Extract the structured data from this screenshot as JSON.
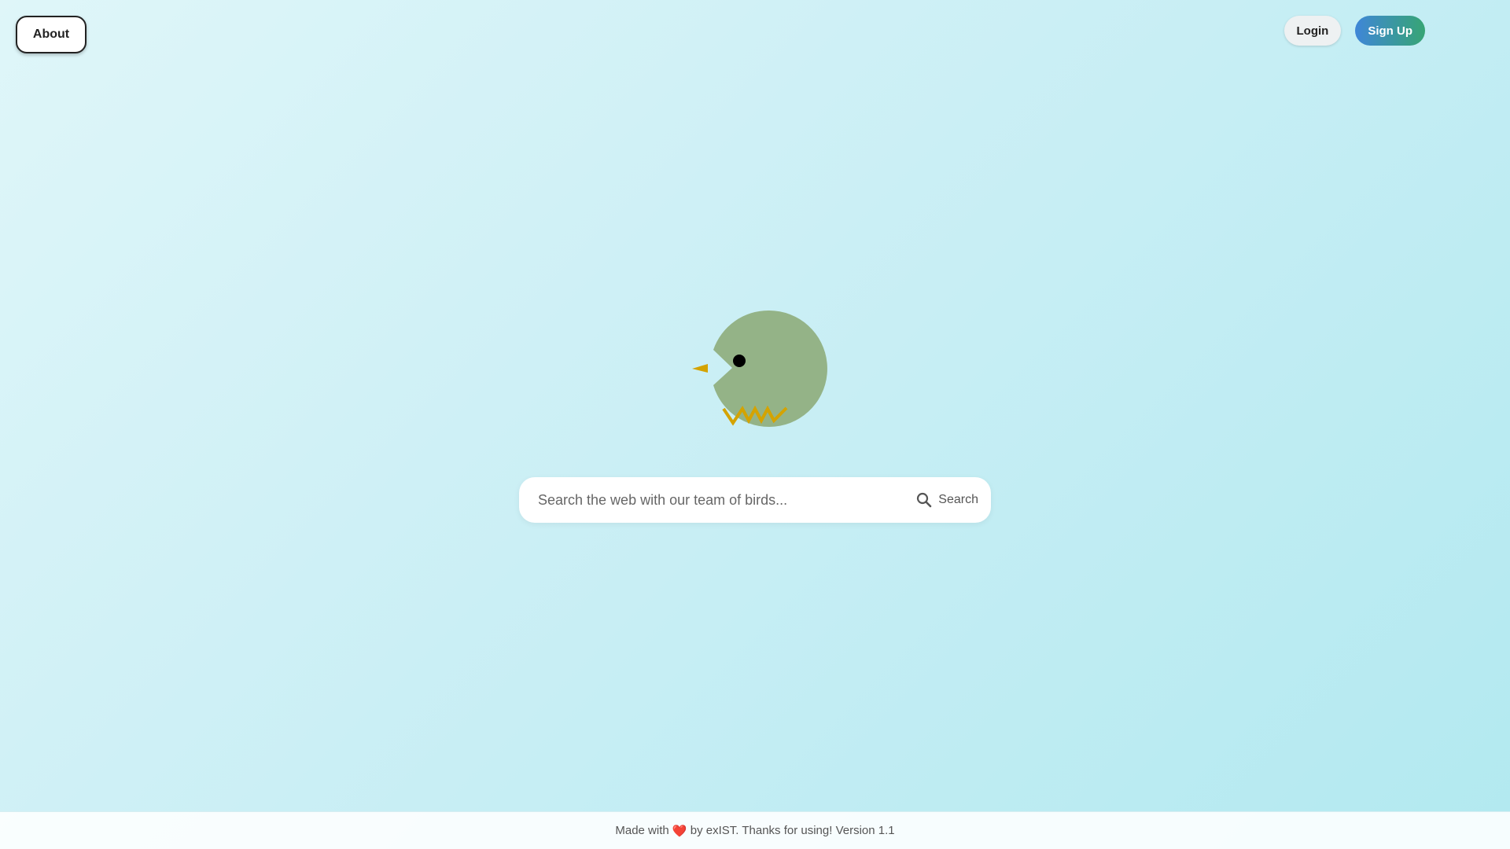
{
  "header": {
    "about_label": "About",
    "login_label": "Login",
    "signup_label": "Sign Up"
  },
  "logo": {
    "icon": "bird-logo-icon",
    "body_color": "#94b387",
    "beak_color": "#d4a300",
    "eye_color": "#000000"
  },
  "search": {
    "placeholder": "Search the web with our team of birds...",
    "value": "",
    "button_label": "Search",
    "button_icon": "search-icon"
  },
  "footer": {
    "prefix": "Made with ",
    "heart": "❤️",
    "suffix": " by exIST. Thanks for using! Version 1.1"
  },
  "colors": {
    "background_start": "#dff6f9",
    "background_end": "#b2e9f0",
    "signup_gradient_start": "#3f86d8",
    "signup_gradient_end": "#37a574"
  }
}
